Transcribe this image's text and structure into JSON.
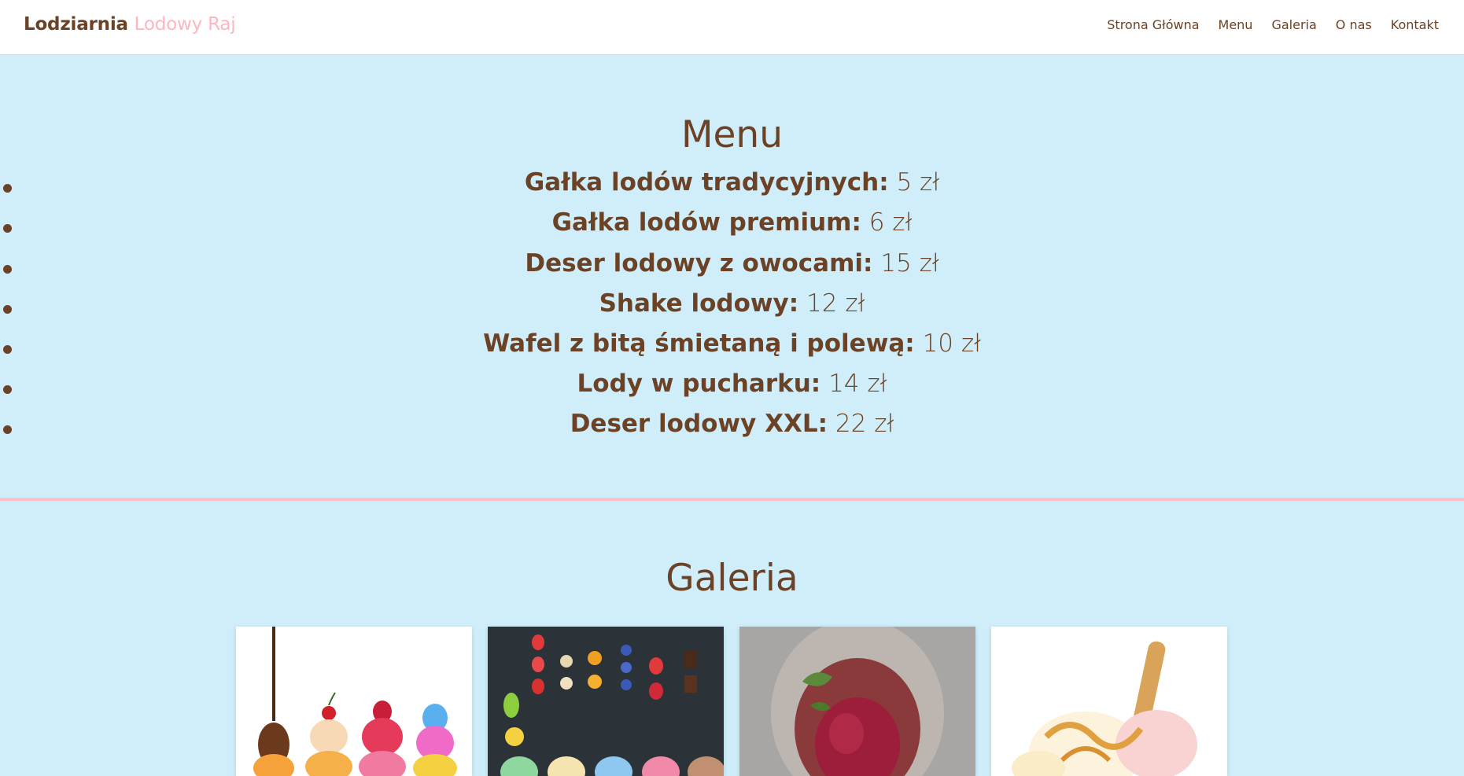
{
  "header": {
    "brand_main": "Lodziarnia",
    "brand_accent": "Lodowy Raj",
    "nav": [
      "Strona Główna",
      "Menu",
      "Galeria",
      "O nas",
      "Kontakt"
    ]
  },
  "menu": {
    "title": "Menu",
    "items": [
      {
        "name": "Gałka lodów tradycyjnych:",
        "price": "5 zł"
      },
      {
        "name": "Gałka lodów premium:",
        "price": "6 zł"
      },
      {
        "name": "Deser lodowy z owocami:",
        "price": "15 zł"
      },
      {
        "name": "Shake lodowy:",
        "price": "12 zł"
      },
      {
        "name": "Wafel z bitą śmietaną i polewą:",
        "price": "10 zł"
      },
      {
        "name": "Lody w pucharku:",
        "price": "14 zł"
      },
      {
        "name": "Deser lodowy XXL:",
        "price": "22 zł"
      }
    ]
  },
  "gallery": {
    "title": "Galeria",
    "images": [
      "ice-cream-cones-image",
      "fruit-and-ice-cream-flatlay-image",
      "berry-sorbet-cup-image",
      "caramel-ice-cream-scoops-image"
    ]
  },
  "colors": {
    "background": "#cfeefa",
    "text": "#6b4226",
    "accent_pink": "#ffb6c1",
    "header_bg": "#ffffff"
  }
}
